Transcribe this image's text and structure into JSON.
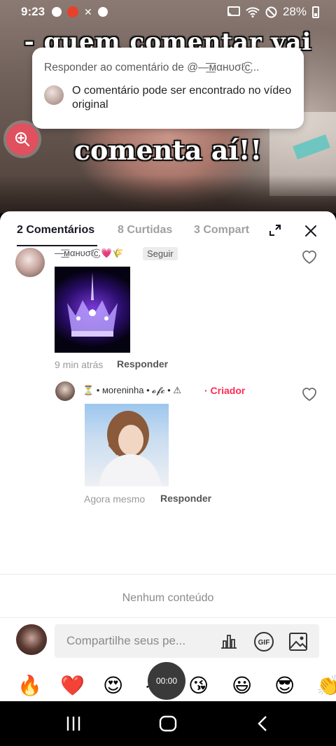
{
  "status_bar": {
    "time": "9:23",
    "battery": "28%"
  },
  "video": {
    "caption_top": "- quem comentar vai",
    "caption_bottom": "comenta aí!!"
  },
  "reply_card": {
    "title": "Responder ao comentário de @—͟͞мαнυσℓ͜͡ᴄ...",
    "message": "O comentário pode ser encontrado no vídeo original"
  },
  "tabs": {
    "comments": "2 Comentários",
    "likes": "8 Curtidas",
    "shares": "3 Compart"
  },
  "comments": [
    {
      "username": "—͟͞мαнυσℓ͜͡ᴄ.💗🌾",
      "follow_label": "Seguir",
      "time": "9 min atrás",
      "reply_label": "Responder"
    },
    {
      "username": "⏳ • мoreninha • 𝓸𝓯𝓬 • ⚠",
      "badge": "· Criador",
      "time": "Agora mesmo",
      "reply_label": "Responder"
    }
  ],
  "empty_state": "Nenhum conteúdo",
  "input": {
    "placeholder": "Compartilhe seus pe..."
  },
  "emojis": [
    "🔥",
    "❤️",
    "😍",
    "😂",
    "😘",
    "😃",
    "😎",
    "👏"
  ],
  "timer": "00:00",
  "colors": {
    "accent": "#fe2c55",
    "zoom_button": "#e0505e"
  }
}
